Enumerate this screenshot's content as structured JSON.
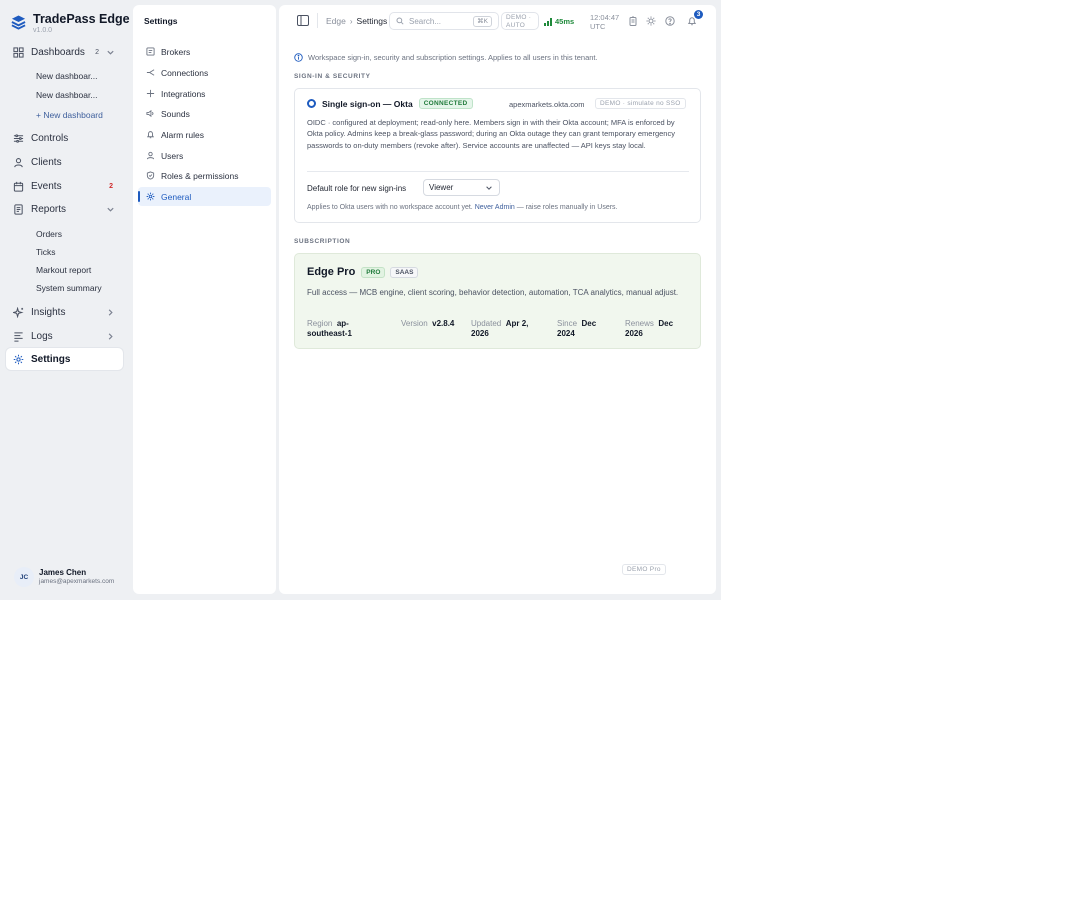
{
  "brand": {
    "name": "TradePass Edge",
    "version": "v1.0.0"
  },
  "sidebar": {
    "dashboards": {
      "label": "Dashboards",
      "count": "2",
      "items": [
        "New dashboar...",
        "New dashboar..."
      ],
      "add_label": "+ New dashboard"
    },
    "controls": "Controls",
    "clients": "Clients",
    "events": {
      "label": "Events",
      "count": "2"
    },
    "reports": {
      "label": "Reports",
      "items": [
        "Orders",
        "Ticks",
        "Markout report",
        "System summary"
      ]
    },
    "insights": "Insights",
    "logs": "Logs",
    "settings": "Settings"
  },
  "user": {
    "initials": "JC",
    "name": "James Chen",
    "email": "james@apexmarkets.com"
  },
  "settings_panel": {
    "title": "Settings",
    "items": [
      "Brokers",
      "Connections",
      "Integrations",
      "Sounds",
      "Alarm rules",
      "Users",
      "Roles & permissions",
      "General"
    ],
    "active": "General"
  },
  "topbar": {
    "breadcrumb": [
      "Edge",
      "Settings"
    ],
    "search_placeholder": "Search...",
    "search_kbd": "⌘K",
    "demo_mode": [
      "DEMO ·",
      "AUTO"
    ],
    "latency": "45ms",
    "time": [
      "12:04:47",
      "UTC"
    ],
    "notifications": "3",
    "colors": {
      "accent": "#1e5bbf",
      "ok": "#1f8a3b"
    }
  },
  "main": {
    "info": "Workspace sign-in, security and subscription settings. Applies to all users in this tenant.",
    "security": {
      "heading": "SIGN-IN & SECURITY",
      "sso_title": "Single sign-on — Okta",
      "status": "CONNECTED",
      "domain": "apexmarkets.okta.com",
      "demo_toggle": "DEMO · simulate no SSO",
      "description": "OIDC · configured at deployment; read-only here. Members sign in with their Okta account; MFA is enforced by Okta policy. Admins keep a break-glass password; during an Okta outage they can grant temporary emergency passwords to on-duty members (revoke after). Service accounts are unaffected — API keys stay local.",
      "default_role_label": "Default role for new sign-ins",
      "default_role_value": "Viewer",
      "note_prefix": "Applies to Okta users with no workspace account yet.",
      "note_highlight": "Never Admin",
      "note_suffix": "— raise roles manually in Users."
    },
    "subscription": {
      "heading": "SUBSCRIPTION",
      "plan": "Edge Pro",
      "tier": "PRO",
      "type": "SAAS",
      "description": "Full access — MCB engine, client scoring, behavior detection, automation, TCA analytics, manual adjust.",
      "meta": [
        {
          "key": "Region",
          "value": "ap-southeast-1"
        },
        {
          "key": "Version",
          "value": "v2.8.4"
        },
        {
          "key": "Updated",
          "value": "Apr 2, 2026"
        },
        {
          "key": "Since",
          "value": "Dec 2024"
        },
        {
          "key": "Renews",
          "value": "Dec 2026"
        }
      ]
    },
    "footer_badge": "DEMO Pro"
  }
}
